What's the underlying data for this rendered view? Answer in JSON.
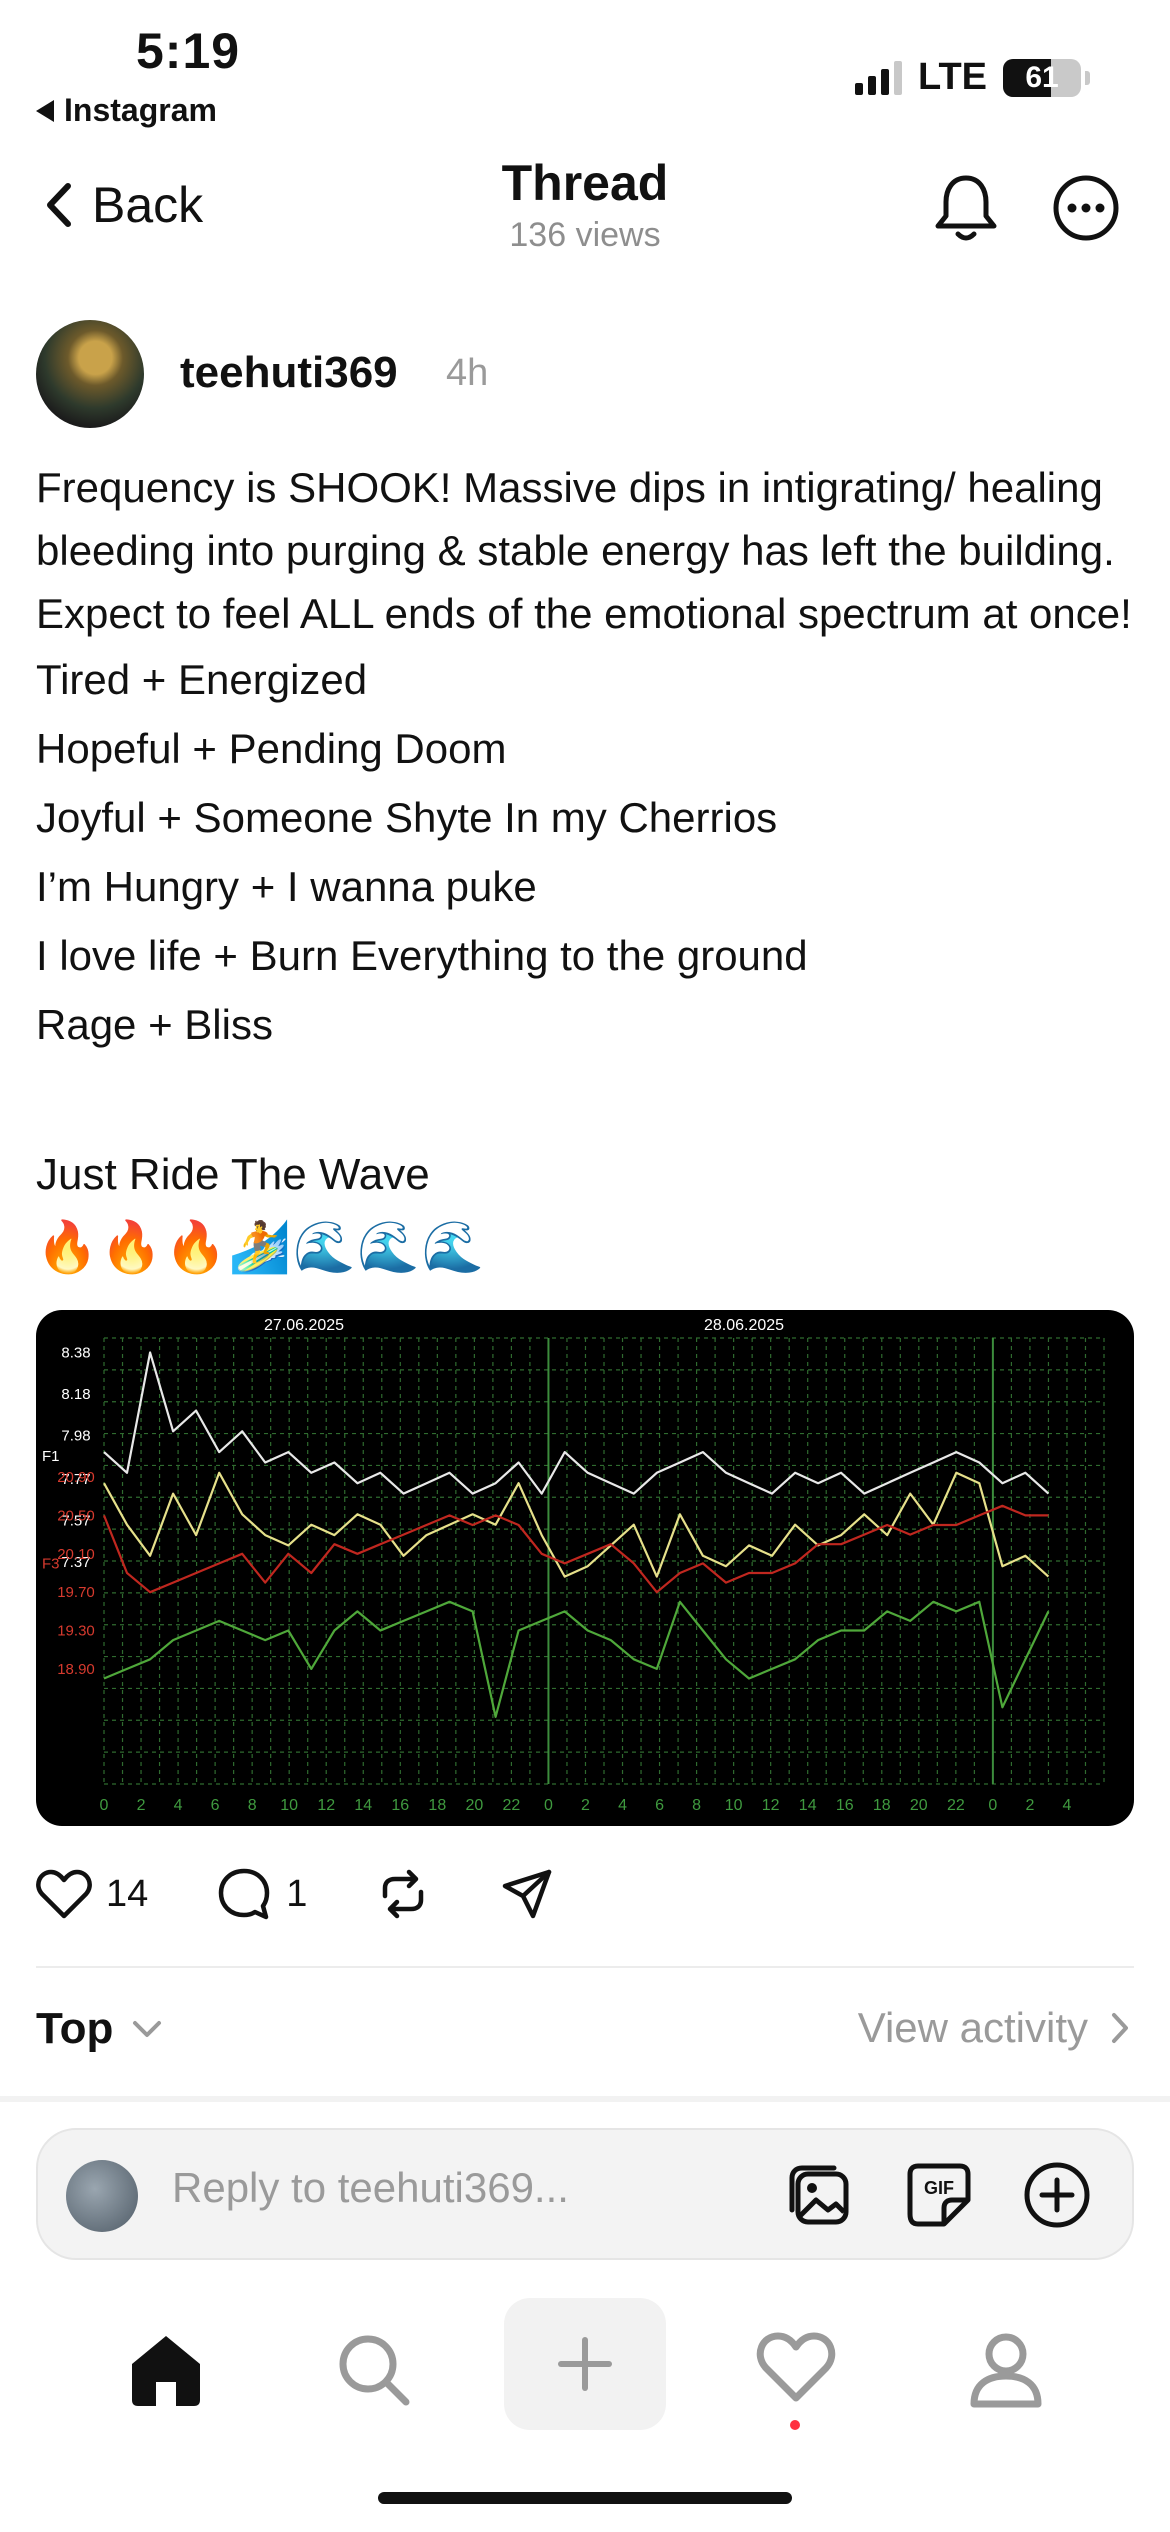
{
  "status_bar": {
    "time": "5:19",
    "back_app": "Instagram",
    "network": "LTE",
    "battery": "61",
    "battery_level_percent": 61,
    "signal_bars_active": 3
  },
  "header": {
    "back_label": "Back",
    "title": "Thread",
    "views": "136 views",
    "icons": [
      "bell-icon",
      "more-icon"
    ]
  },
  "post": {
    "username": "teehuti369",
    "time_ago": "4h",
    "paragraph": "Frequency is SHOOK! Massive dips in intigrating/ healing bleeding into purging & stable energy has left the building. Expect to feel ALL ends of the emotional spectrum at once!",
    "lines": [
      "Tired + Energized",
      "Hopeful + Pending Doom",
      "Joyful + Someone Shyte In my Cherrios",
      "I’m Hungry + I wanna puke",
      "I love life + Burn Everything to the ground",
      "Rage + Bliss"
    ],
    "closing": "Just Ride The Wave",
    "emojis": "🔥🔥🔥🏄🌊🌊🌊"
  },
  "chart_data": {
    "type": "line",
    "date_labels": [
      "27.06.2025",
      "28.06.2025"
    ],
    "f1_label": "F1",
    "f3_label": "F3",
    "f1_ticks": [
      "8.38",
      "8.18",
      "7.98",
      "7.77",
      "7.57",
      "7.37"
    ],
    "f3_ticks": [
      "20.90",
      "20.50",
      "20.10",
      "19.70",
      "19.30",
      "18.90"
    ],
    "x_ticks": [
      "0",
      "2",
      "4",
      "6",
      "8",
      "10",
      "12",
      "14",
      "16",
      "18",
      "20",
      "22",
      "0",
      "2",
      "4",
      "6",
      "8",
      "10",
      "12",
      "14",
      "16",
      "18",
      "20",
      "22",
      "0",
      "2",
      "4"
    ],
    "grid": true,
    "colors": {
      "white": "#e8e8e8",
      "yellow": "#e6e08a",
      "red": "#c0271f",
      "green": "#4fa83a",
      "grid": "#2f6b2f",
      "f1_tick": "#ffffff",
      "f3_tick": "#d63a2e",
      "x_tick": "#3f9a3f"
    },
    "series": [
      {
        "color": "white",
        "values": [
          7.9,
          7.8,
          8.38,
          8.0,
          8.1,
          7.9,
          8.0,
          7.85,
          7.9,
          7.8,
          7.85,
          7.75,
          7.8,
          7.7,
          7.75,
          7.8,
          7.7,
          7.75,
          7.85,
          7.7,
          7.9,
          7.8,
          7.75,
          7.7,
          7.8,
          7.85,
          7.9,
          7.8,
          7.75,
          7.7,
          7.8,
          7.75,
          7.8,
          7.7,
          7.75,
          7.8,
          7.85,
          7.9,
          7.85,
          7.75,
          7.8,
          7.7
        ]
      },
      {
        "color": "yellow",
        "values": [
          7.75,
          7.55,
          7.4,
          7.7,
          7.5,
          7.8,
          7.6,
          7.5,
          7.45,
          7.55,
          7.5,
          7.6,
          7.55,
          7.4,
          7.5,
          7.55,
          7.6,
          7.55,
          7.75,
          7.5,
          7.3,
          7.35,
          7.45,
          7.55,
          7.3,
          7.6,
          7.4,
          7.35,
          7.45,
          7.4,
          7.55,
          7.45,
          7.5,
          7.6,
          7.5,
          7.7,
          7.55,
          7.8,
          7.75,
          7.35,
          7.4,
          7.3
        ]
      },
      {
        "color": "red",
        "values": [
          20.5,
          19.9,
          19.7,
          19.8,
          19.9,
          20.0,
          20.1,
          19.8,
          20.1,
          19.9,
          20.2,
          20.1,
          20.2,
          20.3,
          20.4,
          20.5,
          20.4,
          20.5,
          20.4,
          20.1,
          20.0,
          20.1,
          20.2,
          20.0,
          19.7,
          19.9,
          20.0,
          19.8,
          19.9,
          19.9,
          20.0,
          20.2,
          20.2,
          20.3,
          20.4,
          20.3,
          20.4,
          20.4,
          20.5,
          20.6,
          20.5,
          20.5
        ]
      },
      {
        "color": "green",
        "values": [
          18.8,
          18.9,
          19.0,
          19.2,
          19.3,
          19.4,
          19.3,
          19.2,
          19.3,
          18.9,
          19.3,
          19.5,
          19.3,
          19.4,
          19.5,
          19.6,
          19.5,
          18.4,
          19.3,
          19.4,
          19.5,
          19.3,
          19.2,
          19.0,
          18.9,
          19.6,
          19.3,
          19.0,
          18.8,
          18.9,
          19.0,
          19.2,
          19.3,
          19.3,
          19.5,
          19.4,
          19.6,
          19.5,
          19.6,
          18.5,
          19.0,
          19.5
        ]
      }
    ]
  },
  "actions": {
    "likes": "14",
    "comments": "1"
  },
  "filter": {
    "sort_label": "Top",
    "view_activity": "View activity"
  },
  "reply": {
    "placeholder": "Reply to teehuti369..."
  },
  "tab_bar": {
    "items": [
      "home-icon",
      "search-icon",
      "new-post-icon",
      "activity-icon",
      "profile-icon"
    ],
    "notification_color": "#ff3040"
  }
}
